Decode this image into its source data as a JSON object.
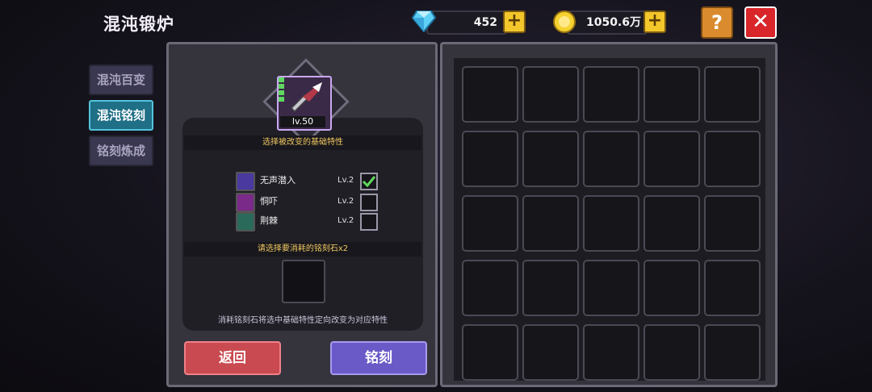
{
  "header": {
    "title": "混沌锻炉",
    "gems": "452",
    "gold": "1050.6万",
    "help": "?",
    "close": "✕"
  },
  "tabs": [
    {
      "label": "混沌百变",
      "active": false
    },
    {
      "label": "混沌铭刻",
      "active": true
    },
    {
      "label": "铭刻炼成",
      "active": false
    }
  ],
  "item": {
    "level": "lv.50"
  },
  "forge": {
    "select_trait_prompt": "选择被改变的基础特性",
    "traits": [
      {
        "name": "无声潜入",
        "level": "Lv.2",
        "checked": true
      },
      {
        "name": "恫吓",
        "level": "Lv.2",
        "checked": false
      },
      {
        "name": "荆棘",
        "level": "Lv.2",
        "checked": false
      }
    ],
    "stone_prompt": "请选择要消耗的铭刻石x2",
    "description": "消耗铭刻石将选中基础特性定向改变为对应特性",
    "back_button": "返回",
    "engrave_button": "铭刻"
  },
  "colors": {
    "accent": "#52c4dc",
    "gold": "#f3c62b",
    "danger": "#d8262a"
  }
}
